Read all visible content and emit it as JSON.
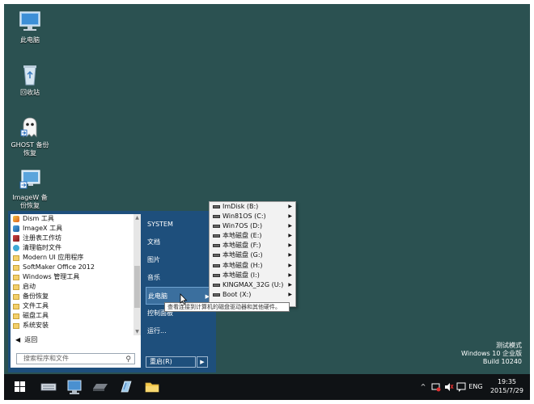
{
  "desktop": {
    "icons": [
      {
        "label": "此电脑",
        "icon": "computer-icon"
      },
      {
        "label": "回收站",
        "icon": "recycle-bin-icon"
      },
      {
        "label": "GHOST 备份恢复",
        "icon": "ghost-icon"
      },
      {
        "label": "ImageW 备份恢复",
        "icon": "imagew-icon"
      }
    ]
  },
  "start_menu": {
    "programs": [
      {
        "label": "Dism 工具",
        "icon": "tool"
      },
      {
        "label": "ImageX 工具",
        "icon": "img"
      },
      {
        "label": "注册表工作坊",
        "icon": "reg"
      },
      {
        "label": "清理临时文件",
        "icon": "clean"
      },
      {
        "label": "Modern UI 应用程序",
        "icon": "folder"
      },
      {
        "label": "SoftMaker Office 2012",
        "icon": "folder"
      },
      {
        "label": "Windows 管理工具",
        "icon": "folder"
      },
      {
        "label": "启动",
        "icon": "folder"
      },
      {
        "label": "备份恢复",
        "icon": "folder"
      },
      {
        "label": "文件工具",
        "icon": "folder"
      },
      {
        "label": "磁盘工具",
        "icon": "folder"
      },
      {
        "label": "系统安装",
        "icon": "folder"
      }
    ],
    "back_label": "返回",
    "search_placeholder": "搜索程序和文件",
    "right_items": [
      {
        "label": "SYSTEM"
      },
      {
        "label": "文档"
      },
      {
        "label": "图片"
      },
      {
        "label": "音乐"
      },
      {
        "label": "此电脑"
      },
      {
        "label": "控制面板"
      },
      {
        "label": "运行..."
      }
    ],
    "restart_label": "重启(R)"
  },
  "drive_menu": {
    "items": [
      {
        "label": "ImDisk (B:)"
      },
      {
        "label": "Win81OS (C:)"
      },
      {
        "label": "Win7OS (D:)"
      },
      {
        "label": "本地磁盘 (E:)"
      },
      {
        "label": "本地磁盘 (F:)"
      },
      {
        "label": "本地磁盘 (G:)"
      },
      {
        "label": "本地磁盘 (H:)"
      },
      {
        "label": "本地磁盘 (I:)"
      },
      {
        "label": "KINGMAX_32G (U:)"
      },
      {
        "label": "Boot (X:)"
      }
    ]
  },
  "tooltip": "查看连接到计算机的磁盘驱动器和其他硬件。",
  "watermark": {
    "line1": "测试模式",
    "line2": "Windows 10 企业版",
    "line3": "Build 10240"
  },
  "taskbar": {
    "lang": "ENG",
    "time": "19:35",
    "date": "2015/7/29"
  },
  "colors": {
    "desktop": "#2b5151",
    "start_menu": "#1e4f7c",
    "taskbar": "#0f1215"
  }
}
